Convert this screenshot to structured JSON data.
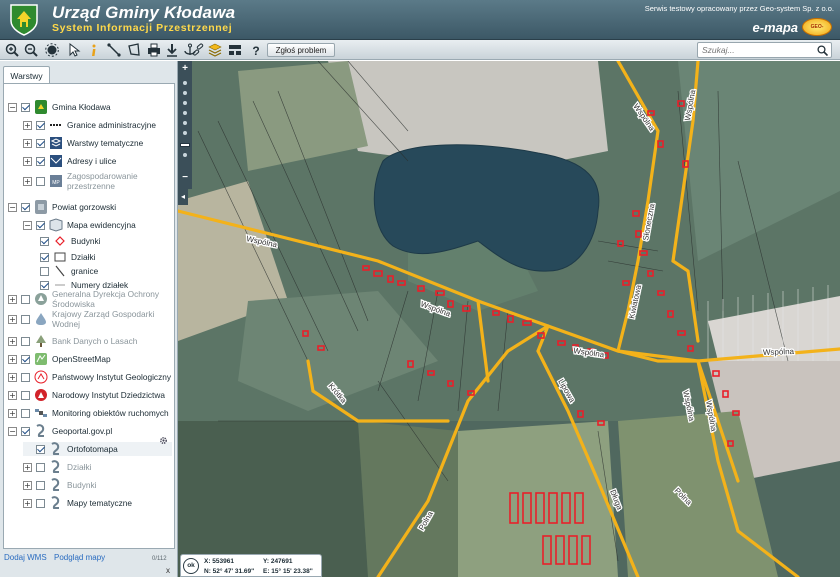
{
  "header": {
    "title": "Urząd Gminy Kłodawa",
    "subtitle": "System Informacji Przestrzennej",
    "provider": "Serwis testowy opracowany przez Geo-system Sp. z o.o.",
    "logo_text": "e-mapa",
    "logo_badge": "GEO-SYSTEM"
  },
  "toolbar": {
    "icons": [
      "zoom-in-icon",
      "zoom-out-icon",
      "full-extent-icon",
      "pan-icon",
      "select-arrow-icon",
      "info-icon",
      "measure-distance-icon",
      "measure-area-icon",
      "print-icon",
      "download-icon",
      "anchor-icon",
      "link-icon",
      "layers-icon",
      "layout-icon",
      "help-icon"
    ],
    "report_label": "Zgłoś problem",
    "search_placeholder": "Szukaj..."
  },
  "sidebar": {
    "tab_label": "Warstwy",
    "layers": [
      {
        "label": "Gmina Kłodawa",
        "level": 0,
        "expander": "-",
        "checked": true,
        "icon": "crest-icon"
      },
      {
        "label": "Granice administracyjne",
        "level": 1,
        "expander": "+",
        "checked": true,
        "icon": "boundary-icon"
      },
      {
        "label": "Warstwy tematyczne",
        "level": 1,
        "expander": "+",
        "checked": true,
        "icon": "stack-icon"
      },
      {
        "label": "Adresy i ulice",
        "level": 1,
        "expander": "+",
        "checked": true,
        "icon": "address-icon"
      },
      {
        "label": "Zagospodarowanie przestrzenne",
        "level": 1,
        "expander": "+",
        "checked": false,
        "icon": "mpzp-icon",
        "muted": true
      },
      {
        "label": "Powiat gorzowski",
        "level": 0,
        "expander": "-",
        "checked": true,
        "icon": "county-crest-icon"
      },
      {
        "label": "Mapa ewidencyjna",
        "level": 1,
        "expander": "-",
        "checked": true,
        "icon": "cadastre-icon"
      },
      {
        "label": "Budynki",
        "level": 2,
        "expander": "",
        "checked": true,
        "icon": "building-outline-icon"
      },
      {
        "label": "Działki",
        "level": 2,
        "expander": "",
        "checked": true,
        "icon": "parcel-outline-icon"
      },
      {
        "label": "granice",
        "level": 2,
        "expander": "",
        "checked": false,
        "icon": "line-icon"
      },
      {
        "label": "Numery działek",
        "level": 2,
        "expander": "",
        "checked": true,
        "icon": "dash-icon"
      },
      {
        "label": "Generalna Dyrekcja Ochrony Środowiska",
        "level": 0,
        "expander": "+",
        "checked": false,
        "icon": "gdos-icon",
        "muted": true
      },
      {
        "label": "Krajowy Zarząd Gospodarki Wodnej",
        "level": 0,
        "expander": "+",
        "checked": false,
        "icon": "water-icon",
        "muted": true
      },
      {
        "label": "Bank Danych o Lasach",
        "level": 0,
        "expander": "+",
        "checked": false,
        "icon": "forest-icon",
        "muted": true
      },
      {
        "label": "OpenStreetMap",
        "level": 0,
        "expander": "+",
        "checked": true,
        "icon": "osm-icon"
      },
      {
        "label": "Państwowy Instytut Geologiczny",
        "level": 0,
        "expander": "+",
        "checked": false,
        "icon": "pig-icon"
      },
      {
        "label": "Narodowy Instytut Dziedzictwa",
        "level": 0,
        "expander": "+",
        "checked": false,
        "icon": "heritage-icon"
      },
      {
        "label": "Monitoring obiektów ruchomych",
        "level": 0,
        "expander": "+",
        "checked": false,
        "icon": "satellite-icon"
      },
      {
        "label": "Geoportal.gov.pl",
        "level": 0,
        "expander": "-",
        "checked": true,
        "icon": "geoportal-icon"
      },
      {
        "label": "Ortofotomapa",
        "level": 1,
        "expander": "",
        "checked": true,
        "icon": "geoportal-icon"
      },
      {
        "label": "Działki",
        "level": 1,
        "expander": "+",
        "checked": false,
        "icon": "geoportal-icon",
        "muted": true
      },
      {
        "label": "Budynki",
        "level": 1,
        "expander": "+",
        "checked": false,
        "icon": "geoportal-icon",
        "muted": true
      },
      {
        "label": "Mapy tematyczne",
        "level": 1,
        "expander": "+",
        "checked": false,
        "icon": "geoportal-icon"
      }
    ],
    "add_wms": "Dodaj WMS",
    "preview_map": "Podgląd mapy",
    "layer_count": "0/112",
    "close": "x"
  },
  "map": {
    "street_names": [
      "Wspólna",
      "Wspólna",
      "Wspólna",
      "Wspólna",
      "Krótka",
      "Polna",
      "Lipowa",
      "Długa",
      "Polna",
      "Kwiatowa",
      "Słoneczna",
      "Wspólna",
      "Wspólna",
      "Wspólna",
      "Wspólna"
    ]
  },
  "coords": {
    "ok_label": "ok",
    "x": "X: 553961",
    "y": "Y: 247691",
    "n": "N: 52° 47' 31.69\"",
    "e": "E: 15° 15' 23.38\""
  },
  "colors": {
    "header": "#3c5866",
    "road": "#f3b21a",
    "building": "#e8202a",
    "link": "#2a6cc0"
  }
}
